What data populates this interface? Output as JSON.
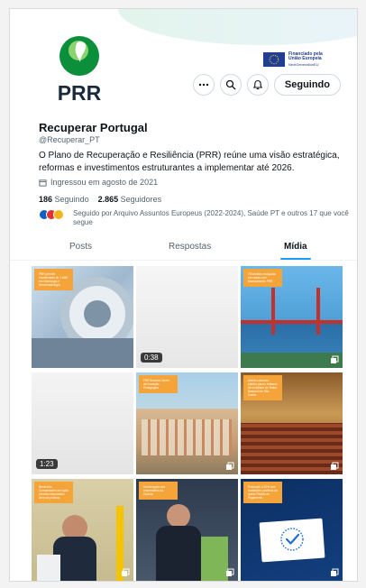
{
  "profile": {
    "brand": "PRR",
    "eu_line1": "Financiado pela",
    "eu_line2": "União Europeia",
    "eu_line3": "NextGenerationEU",
    "name": "Recuperar Portugal",
    "handle": "@Recuperar_PT",
    "bio": "O Plano de Recuperação e Resiliência (PRR) reúne uma visão estratégica, reformas e investimentos estruturantes a implementar até 2026.",
    "joined": "Ingressou em agosto de 2021",
    "following_count": "186",
    "following_label": "Seguindo",
    "followers_count": "2.865",
    "followers_label": "Seguidores",
    "followed_by": "Seguido por Arquivo Assuntos Europeus (2022-2024), Saúde PT e outros 17 que você segue"
  },
  "actions": {
    "more_icon": "more-icon",
    "search_icon": "search-icon",
    "notify_icon": "notification-icon",
    "follow_label": "Seguindo"
  },
  "tabs": [
    {
      "label": "Posts"
    },
    {
      "label": "Respostas"
    },
    {
      "label": "Mídia"
    }
  ],
  "media": [
    {
      "tag": "PRR permite investimento de 1.6M€ em Radiologia e Neurorradiologia",
      "duration": ""
    },
    {
      "tag": "",
      "duration": "0:38"
    },
    {
      "tag": "75 famílias realojadas em casas com financiamento PRR",
      "duration": ""
    },
    {
      "tag": "",
      "duration": "1:23"
    },
    {
      "tag": "PRR financia Centro de Inovação Pedagógica",
      "duration": ""
    },
    {
      "tag": "Aberto concurso público para o restauro de mobiliário do Teatro Nacional de São Carlos",
      "duration": ""
    },
    {
      "tag": "Seminário Comunidades em Ação permitiu intercâmbio de boas práticas",
      "duration": ""
    },
    {
      "tag": "Homenagem aos empresários da Guarda",
      "duration": ""
    },
    {
      "tag": "Execução a 32% com avaliações positivas do quinto Pedido de Pagamento",
      "duration": ""
    }
  ],
  "colors": {
    "accent": "#1d9bf0",
    "tag": "#f5a43a",
    "text": "#0f1419",
    "muted": "#536471"
  }
}
